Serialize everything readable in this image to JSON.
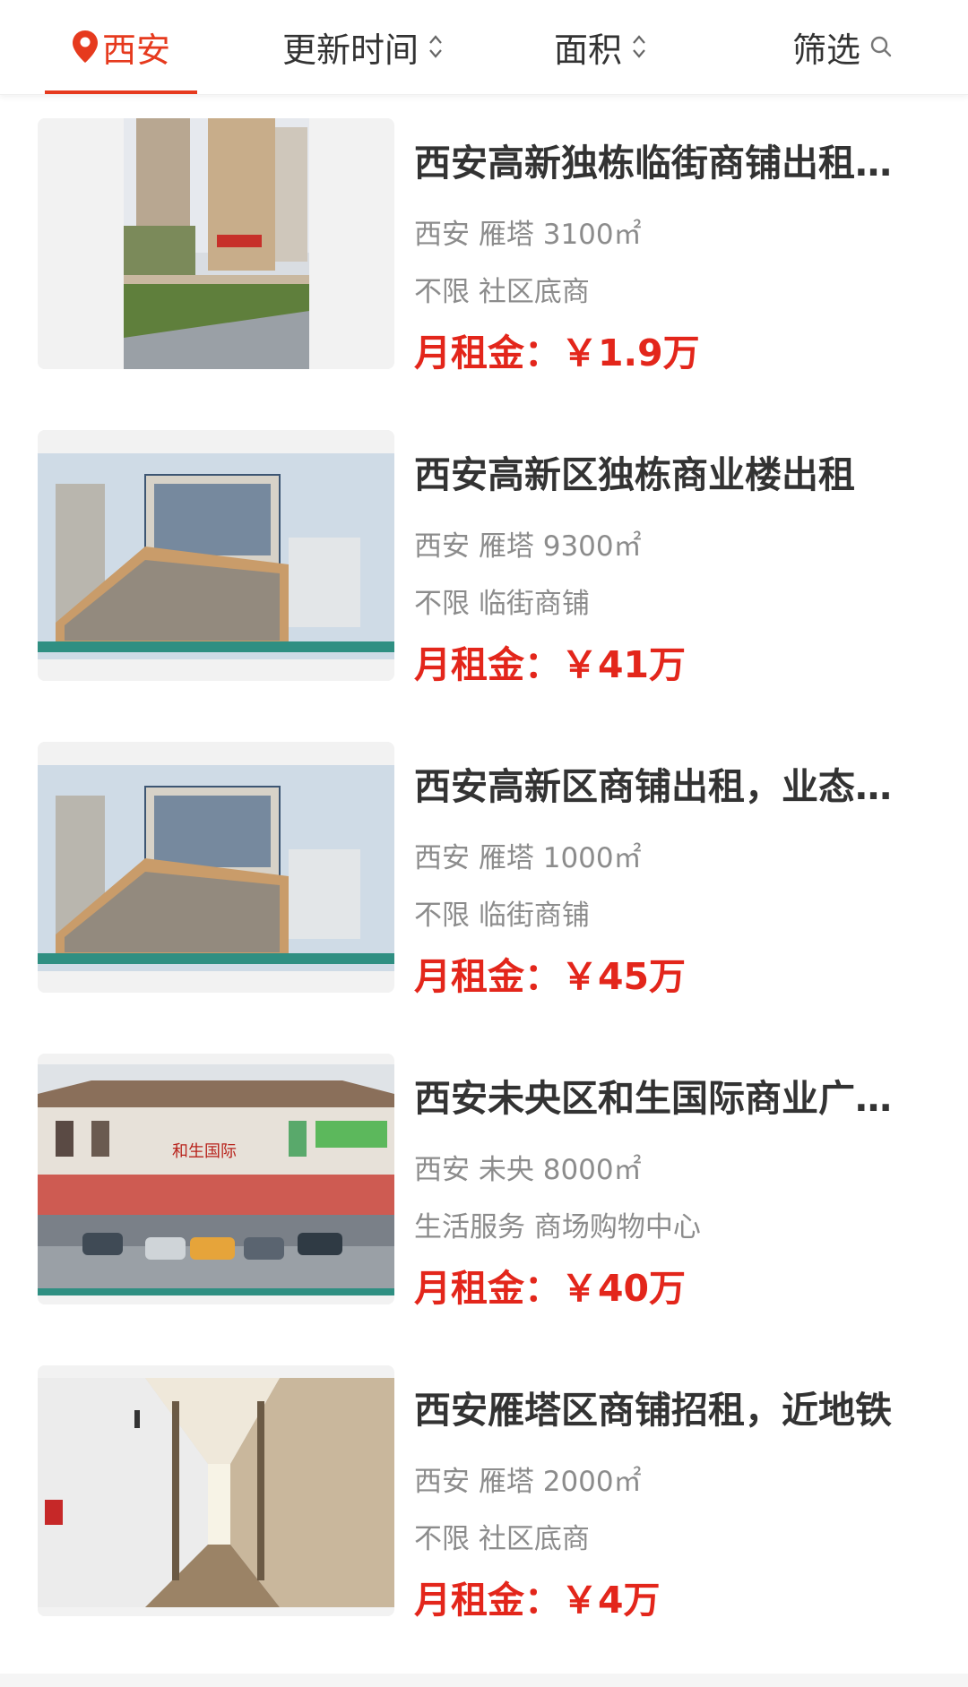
{
  "header": {
    "city_label": "西安",
    "sort_time_label": "更新时间",
    "sort_area_label": "面积",
    "filter_label": "筛选",
    "accent_color": "#e63a1e"
  },
  "listings": [
    {
      "title": "西安高新独栋临街商铺出租，位置佳",
      "location": "西安",
      "district": "雁塔",
      "area": "3100㎡",
      "category": "不限",
      "type": "社区底商",
      "price_label": "月租金：",
      "price_value": "￥1.9万"
    },
    {
      "title": "西安高新区独栋商业楼出租",
      "location": "西安",
      "district": "雁塔",
      "area": "9300㎡",
      "category": "不限",
      "type": "临街商铺",
      "price_label": "月租金：",
      "price_value": "￥41万"
    },
    {
      "title": "西安高新区商铺出租，业态不限",
      "location": "西安",
      "district": "雁塔",
      "area": "1000㎡",
      "category": "不限",
      "type": "临街商铺",
      "price_label": "月租金：",
      "price_value": "￥45万"
    },
    {
      "title": "西安未央区和生国际商业广场出租",
      "location": "西安",
      "district": "未央",
      "area": "8000㎡",
      "category": "生活服务",
      "type": "商场购物中心",
      "price_label": "月租金：",
      "price_value": "￥40万",
      "sign_text": "和生国际"
    },
    {
      "title": "西安雁塔区商铺招租，近地铁",
      "location": "西安",
      "district": "雁塔",
      "area": "2000㎡",
      "category": "不限",
      "type": "社区底商",
      "price_label": "月租金：",
      "price_value": "￥4万"
    }
  ]
}
